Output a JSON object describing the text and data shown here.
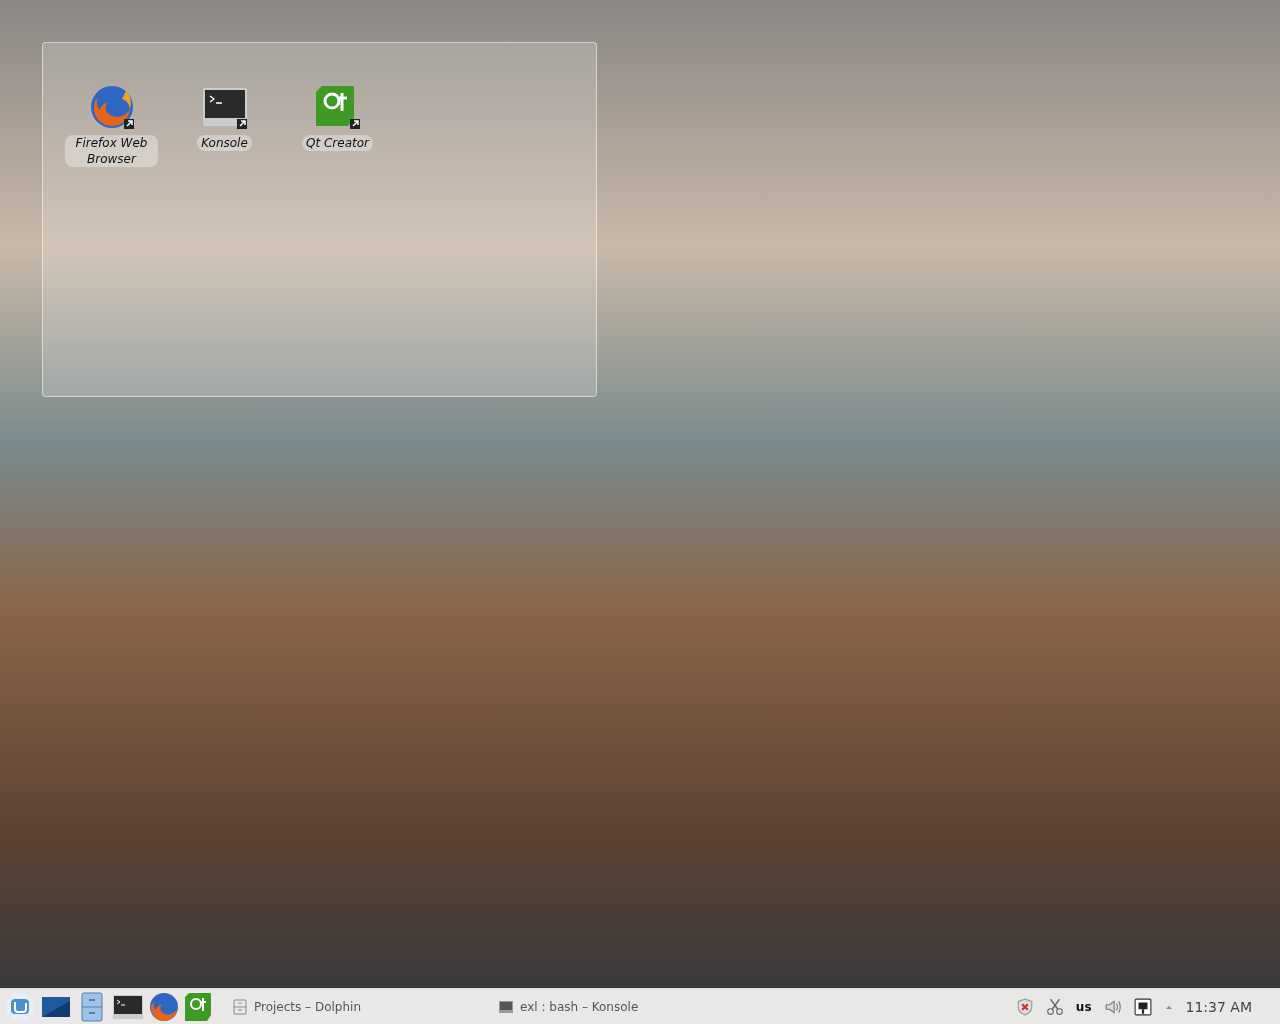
{
  "desktop_icons": [
    {
      "label": "Firefox Web Browser",
      "kind": "firefox"
    },
    {
      "label": "Konsole",
      "kind": "konsole"
    },
    {
      "label": "Qt Creator",
      "kind": "qt"
    }
  ],
  "taskbar": {
    "launchers": [
      {
        "kind": "menu"
      },
      {
        "kind": "desktop"
      },
      {
        "kind": "files"
      },
      {
        "kind": "konsole"
      },
      {
        "kind": "firefox"
      },
      {
        "kind": "qt"
      }
    ],
    "tasks": [
      {
        "title": "Projects – Dolphin",
        "kind": "dolphin"
      },
      {
        "title": "exl : bash – Konsole",
        "kind": "konsole"
      }
    ],
    "tray": {
      "keyboard_layout": "us"
    },
    "clock": "11:37 AM"
  }
}
